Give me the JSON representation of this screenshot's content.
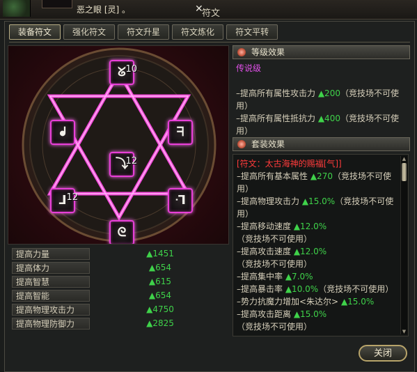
{
  "top": {
    "item_name": "恶之眼 [灵] 。",
    "window_title": "符文"
  },
  "tabs": [
    {
      "label": "装备符文",
      "active": true
    },
    {
      "label": "强化符文",
      "active": false
    },
    {
      "label": "符文升星",
      "active": false
    },
    {
      "label": "符文炼化",
      "active": false
    },
    {
      "label": "符文平转",
      "active": false
    }
  ],
  "runes": [
    {
      "pos": "top",
      "glyph": "ᘜ",
      "level": "10"
    },
    {
      "pos": "upper-left",
      "glyph": "ᖱ",
      "level": ""
    },
    {
      "pos": "upper-right",
      "glyph": "ᖷ",
      "level": ""
    },
    {
      "pos": "center",
      "glyph": "⤵",
      "level": "12"
    },
    {
      "pos": "lower-left",
      "glyph": "ᒧ",
      "level": "12"
    },
    {
      "pos": "lower-right",
      "glyph": "ᒬ",
      "level": ""
    },
    {
      "pos": "bottom",
      "glyph": "ᘓ",
      "level": ""
    }
  ],
  "stats": [
    {
      "label": "提高力量",
      "value": "▲1451"
    },
    {
      "label": "提高体力",
      "value": "▲654"
    },
    {
      "label": "提高智慧",
      "value": "▲615"
    },
    {
      "label": "提高智能",
      "value": "▲654"
    },
    {
      "label": "提高物理攻击力",
      "value": "▲4750"
    },
    {
      "label": "提高物理防御力",
      "value": "▲2825"
    }
  ],
  "level_effect": {
    "header": "等级效果",
    "grade": "传说级",
    "lines": [
      {
        "text": "–提高所有属性攻击力 ",
        "val": "▲200",
        "tail": "（竞技场不可使用）"
      },
      {
        "text": "–提高所有属性抵抗力 ",
        "val": "▲400",
        "tail": "（竞技场不可使用）"
      }
    ]
  },
  "set_effect": {
    "header": "套装效果",
    "name": "[符文：太古海神的赐福[气]]",
    "lines": [
      {
        "text": "–提高所有基本属性 ",
        "val": "▲270",
        "tail": "（竞技场不可使用）"
      },
      {
        "text": "–提高物理攻击力 ",
        "val": "▲15.0%",
        "tail": "（竞技场不可使用）"
      },
      {
        "text": "–提高移动速度 ",
        "val": "▲12.0%",
        "tail": "（竞技场不可使用）"
      },
      {
        "text": "–提高攻击速度 ",
        "val": "▲12.0%",
        "tail": "（竞技场不可使用）"
      },
      {
        "text": "–提高集中率 ",
        "val": "▲7.0%",
        "tail": ""
      },
      {
        "text": "–提高暴击率 ",
        "val": "▲10.0%",
        "tail": "（竞技场不可使用）"
      },
      {
        "text": "–势力抗魔力增加<朱达尔> ",
        "val": "▲15.0%",
        "tail": ""
      },
      {
        "text": "–提高攻击距离 ",
        "val": "▲15.0%",
        "tail": "（竞技场不可使用）"
      }
    ]
  },
  "close_label": "关闭",
  "colors": {
    "accent_green": "#3fd24a",
    "grade_purple": "#e050e8",
    "set_red": "#ff3b3b",
    "rune_glow": "#e83fd8"
  }
}
